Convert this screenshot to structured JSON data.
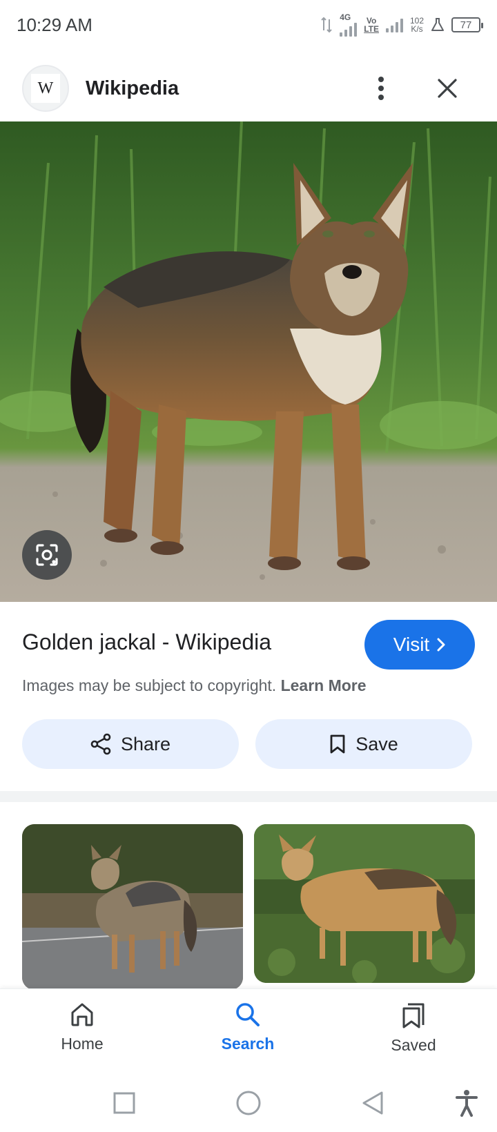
{
  "status_bar": {
    "time": "10:29 AM",
    "network_type": "4G",
    "volte_top": "Vo",
    "volte_bottom": "LTE",
    "speed_value": "102",
    "speed_unit": "K/s",
    "battery": "77"
  },
  "header": {
    "site_logo_letter": "W",
    "site_name": "Wikipedia"
  },
  "result": {
    "title": "Golden jackal - Wikipedia",
    "visit_label": "Visit",
    "copyright_text": "Images may be subject to copyright.",
    "learn_more_label": "Learn More",
    "share_label": "Share",
    "save_label": "Save"
  },
  "bottom_nav": {
    "items": [
      {
        "label": "Home",
        "icon": "home-icon",
        "active": false
      },
      {
        "label": "Search",
        "icon": "search-icon",
        "active": true
      },
      {
        "label": "Saved",
        "icon": "saved-icon",
        "active": false
      }
    ]
  },
  "colors": {
    "accent": "#1a73e8",
    "action_button_bg": "#e8f0fe",
    "text_primary": "#202124",
    "text_secondary": "#5f6368"
  }
}
